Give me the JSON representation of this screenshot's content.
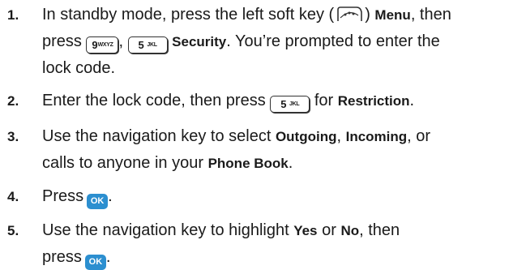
{
  "steps": [
    {
      "number": "1.",
      "line1_a": "In standby mode, press the left soft key (",
      "softkey_label": ")",
      "menu": "Menu",
      "line1_b": ", then",
      "line2_a": "press",
      "key9_digit": "9",
      "key9_letters": "WXYZ",
      "comma": ",",
      "key5_digit": "5",
      "key5_letters": "JKL",
      "security": "Security",
      "line2_b": ". You’re prompted to enter the",
      "line3": "lock code."
    },
    {
      "number": "2.",
      "text_a": "Enter the lock code, then press",
      "key5_digit": "5",
      "key5_letters": "JKL",
      "text_b": "for",
      "restriction": "Restriction",
      "text_c": "."
    },
    {
      "number": "3.",
      "line1_a": "Use the navigation key to select",
      "outgoing": "Outgoing",
      "sep1": ",",
      "incoming": "Incoming",
      "line1_b": ", or",
      "line2_a": "calls to anyone in your",
      "phonebook": "Phone Book",
      "line2_b": "."
    },
    {
      "number": "4.",
      "text_a": "Press",
      "ok_label": "OK",
      "text_b": "."
    },
    {
      "number": "5.",
      "line1_a": "Use the navigation key to highlight",
      "yes": "Yes",
      "or": "or",
      "no": "No",
      "line1_b": ", then",
      "line2_a": "press",
      "ok_label": "OK",
      "line2_b": "."
    }
  ],
  "colors": {
    "ok_key": "#2c8fd0",
    "text": "#1a1a1a"
  },
  "icons": [
    "left-softkey-icon",
    "key-9-icon",
    "key-5-icon",
    "ok-key-icon"
  ]
}
